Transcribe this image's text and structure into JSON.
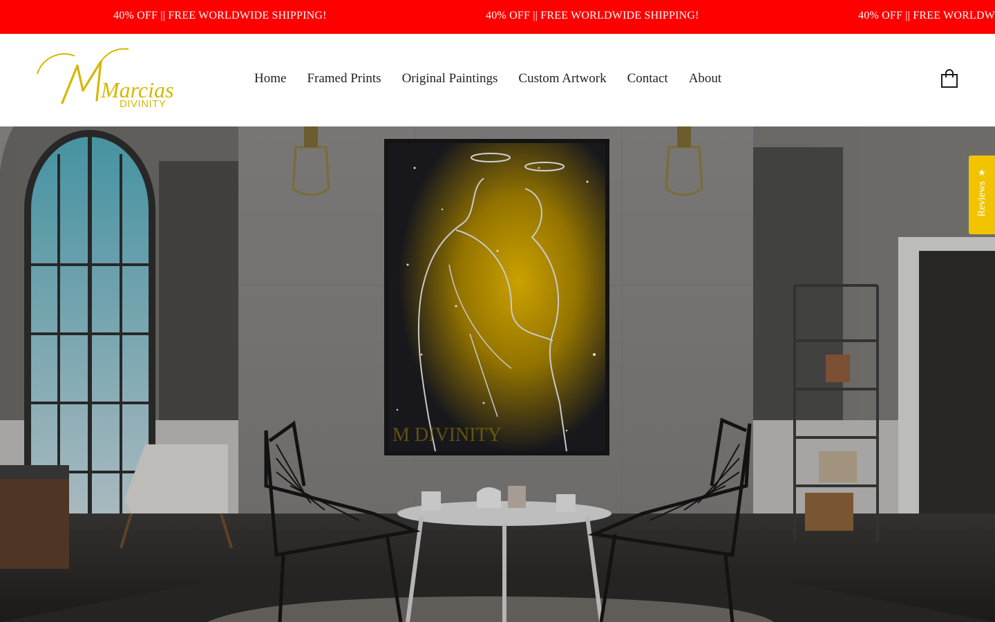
{
  "announcement": {
    "messages": [
      "40% OFF || FREE WORLDWIDE SHIPPING!",
      "40% OFF || FREE WORLDWIDE SHIPPING!",
      "40% OFF || FREE WORLDWIDE SHIPPING!"
    ],
    "background": "#ff0000"
  },
  "brand": {
    "script_name": "Marcias",
    "sub_name": "DIVINITY",
    "color": "#d4b800"
  },
  "nav": {
    "items": [
      "Home",
      "Framed Prints",
      "Original Paintings",
      "Custom Artwork",
      "Contact",
      "About"
    ]
  },
  "cart": {
    "icon": "shopping-bag-icon"
  },
  "reviews_tab": {
    "label": "Reviews",
    "icon": "star-icon",
    "color": "#f2c400"
  },
  "hero": {
    "artwork_watermark": "M DIVINITY"
  }
}
